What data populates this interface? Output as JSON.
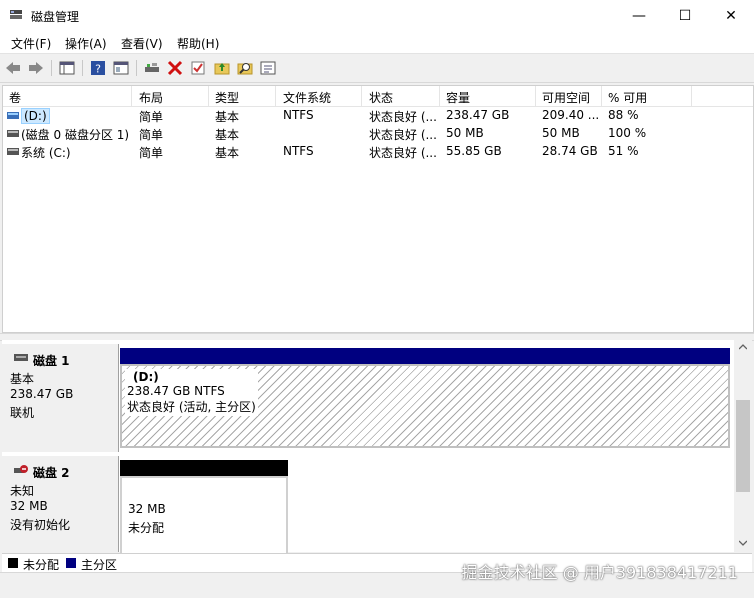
{
  "window": {
    "title": "磁盘管理",
    "minimize": "—",
    "maximize": "☐",
    "close": "✕"
  },
  "menu": [
    "文件(F)",
    "操作(A)",
    "查看(V)",
    "帮助(H)"
  ],
  "toolbar": [
    "back-icon",
    "forward-icon",
    "console-icon",
    "help-icon",
    "view-icon",
    "connect-icon",
    "delete-icon",
    "check-icon",
    "folder-up-icon",
    "search-folder-icon",
    "properties-icon"
  ],
  "columns": [
    "卷",
    "布局",
    "类型",
    "文件系统",
    "状态",
    "容量",
    "可用空间",
    "% 可用"
  ],
  "volumes": [
    {
      "name": "(D:)",
      "layout": "简单",
      "type": "基本",
      "fs": "NTFS",
      "status": "状态良好 (...",
      "capacity": "238.47 GB",
      "free": "209.40 ...",
      "pct": "88 %"
    },
    {
      "name": "(磁盘 0 磁盘分区 1)",
      "layout": "简单",
      "type": "基本",
      "fs": "",
      "status": "状态良好 (...",
      "capacity": "50 MB",
      "free": "50 MB",
      "pct": "100 %"
    },
    {
      "name": "系统 (C:)",
      "layout": "简单",
      "type": "基本",
      "fs": "NTFS",
      "status": "状态良好 (...",
      "capacity": "55.85 GB",
      "free": "28.74 GB",
      "pct": "51 %"
    }
  ],
  "disks": [
    {
      "name": "磁盘 1",
      "kind": "基本",
      "size": "238.47 GB",
      "state": "联机",
      "partition": {
        "label": "(D:)",
        "size_fs": "238.47 GB NTFS",
        "status": "状态良好 (活动, 主分区)"
      }
    },
    {
      "name": "磁盘 2",
      "kind": "未知",
      "size": "32 MB",
      "state": "没有初始化",
      "partition": {
        "size": "32 MB",
        "status": "未分配"
      }
    }
  ],
  "legend": {
    "unallocated": "未分配",
    "primary": "主分区"
  },
  "watermark": "掘金技术社区 @ 用户391838417211",
  "colors": {
    "primary": "#000080",
    "unallocated": "#000000",
    "selection": "#cce8ff"
  }
}
